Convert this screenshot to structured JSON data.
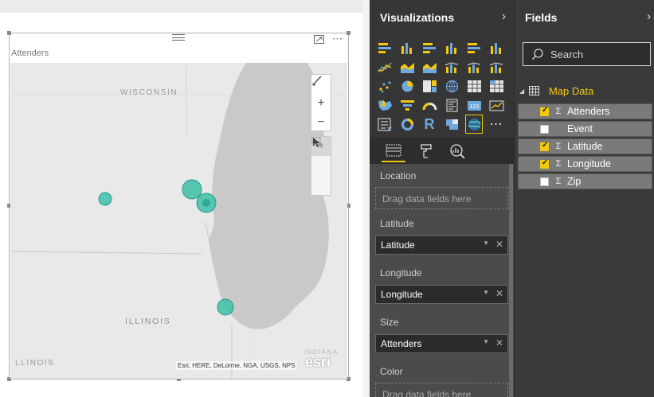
{
  "visual": {
    "title": "Attenders",
    "more_label": "⋯",
    "map_labels": {
      "wisconsin": "WISCONSIN",
      "illinois": "ILLINOIS",
      "illinois_edge": "LLINOIS",
      "indiana_edge": "INDIANA"
    },
    "attribution": "Esri, HERE, DeLorme, NGA, USGS, NPS",
    "esri_logo": "esri",
    "bubble_color": "#3dbfa8",
    "tools": {
      "zoom_in": "+",
      "zoom_out": "−"
    }
  },
  "visualizations_pane": {
    "title": "Visualizations",
    "collapse": "›",
    "gallery_icons": [
      "stacked-bar-chart-icon",
      "stacked-column-chart-icon",
      "clustered-bar-chart-icon",
      "clustered-column-chart-icon",
      "100-percent-bar-chart-icon",
      "100-percent-column-chart-icon",
      "line-chart-icon",
      "area-chart-icon",
      "stacked-area-chart-icon",
      "line-and-column-chart-icon",
      "line-and-clustered-column-chart-icon",
      "ribbon-chart-icon",
      "scatter-chart-icon",
      "pie-chart-icon",
      "treemap-icon",
      "globe-map-icon",
      "table-icon",
      "matrix-icon",
      "filled-map-icon",
      "funnel-icon",
      "gauge-icon",
      "multi-row-card-icon",
      "card-icon",
      "kpi-icon",
      "slicer-icon",
      "donut-chart-icon",
      "r-visual-icon",
      "shape-map-icon",
      "arcgis-map-icon",
      "more-visuals-icon"
    ],
    "selected_icon_index": 28,
    "r_letter": "R",
    "card_number": "123",
    "more_glyph": "⋯",
    "wells": [
      {
        "label": "Location",
        "placeholder": "Drag data fields here"
      },
      {
        "label": "Latitude",
        "field": "Latitude"
      },
      {
        "label": "Longitude",
        "field": "Longitude"
      },
      {
        "label": "Size",
        "field": "Attenders"
      },
      {
        "label": "Color",
        "placeholder": "Drag data fields here"
      }
    ],
    "remove_glyph": "✕",
    "dropdown_glyph": "▼"
  },
  "fields_pane": {
    "title": "Fields",
    "collapse": "›",
    "search_placeholder": "Search",
    "table_name": "Map Data",
    "caret": "◢",
    "fields": [
      {
        "name": "Attenders",
        "checked": true,
        "sigma": "Σ"
      },
      {
        "name": "Event",
        "checked": false,
        "sigma": ""
      },
      {
        "name": "Latitude",
        "checked": true,
        "sigma": "Σ"
      },
      {
        "name": "Longitude",
        "checked": true,
        "sigma": "Σ"
      },
      {
        "name": "Zip",
        "checked": false,
        "sigma": "Σ"
      }
    ]
  },
  "colors": {
    "accent": "#f2c811",
    "pane_bg": "#363636",
    "field_bg": "#7a7a7a"
  }
}
